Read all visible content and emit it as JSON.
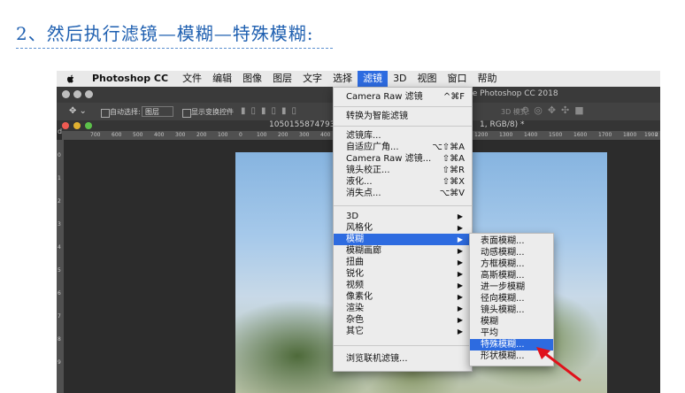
{
  "heading": "2、然后执行滤镜—模糊—特殊模糊:",
  "menubar": {
    "app_name": "Photoshop CC",
    "items": [
      "文件",
      "编辑",
      "图像",
      "图层",
      "文字",
      "选择",
      "滤镜",
      "3D",
      "视图",
      "窗口",
      "帮助"
    ]
  },
  "title_bar": {
    "text": "be Photoshop CC 2018"
  },
  "options_bar": {
    "auto_select_label": "自动选择:",
    "auto_select_value": "图层",
    "show_transform_label": "显示变换控件",
    "mode_3d_label": "3D 模式:"
  },
  "doc_tab": {
    "title_left": "1050155874793",
    "title_right": "1, RGB/8) *"
  },
  "ruler": {
    "h_ticks": [
      "700",
      "600",
      "500",
      "400",
      "300",
      "200",
      "100",
      "0",
      "100",
      "200",
      "300",
      "400",
      "1200",
      "1300",
      "1400",
      "1500",
      "1600",
      "1700",
      "1800",
      "1900",
      "2"
    ],
    "v_ticks": [
      "0",
      "1",
      "2",
      "3",
      "4",
      "5",
      "6",
      "7",
      "8",
      "9"
    ]
  },
  "filter_menu": {
    "camera_raw_last": {
      "label": "Camera Raw 滤镜",
      "shortcut": "^⌘F"
    },
    "convert_smart": {
      "label": "转换为智能滤镜"
    },
    "gallery": {
      "label": "滤镜库..."
    },
    "adaptive_wide": {
      "label": "自适应广角...",
      "shortcut": "⌥⇧⌘A"
    },
    "camera_raw": {
      "label": "Camera Raw 滤镜...",
      "shortcut": "⇧⌘A"
    },
    "lens_correction": {
      "label": "镜头校正...",
      "shortcut": "⇧⌘R"
    },
    "liquify": {
      "label": "液化...",
      "shortcut": "⇧⌘X"
    },
    "vanishing_point": {
      "label": "消失点...",
      "shortcut": "⌥⌘V"
    },
    "groups": [
      "3D",
      "风格化",
      "模糊",
      "模糊画廊",
      "扭曲",
      "锐化",
      "视频",
      "像素化",
      "渲染",
      "杂色",
      "其它"
    ],
    "browse_online": {
      "label": "浏览联机滤镜..."
    }
  },
  "blur_submenu": {
    "items": [
      "表面模糊...",
      "动感模糊...",
      "方框模糊...",
      "高斯模糊...",
      "进一步模糊",
      "径向模糊...",
      "镜头模糊...",
      "模糊",
      "平均",
      "特殊模糊...",
      "形状模糊..."
    ],
    "highlighted": "特殊模糊..."
  },
  "colors": {
    "accent": "#2d6be0",
    "heading": "#1e5fb0",
    "annotation_arrow": "#e0121b"
  }
}
